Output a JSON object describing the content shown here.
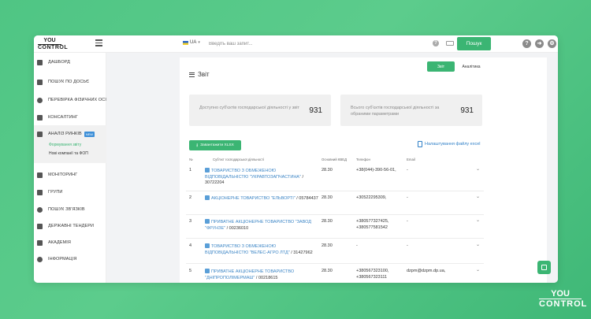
{
  "brand": {
    "logo_line1": "YOU",
    "logo_line2": "CONTROL"
  },
  "topbar": {
    "language": "UA",
    "search_placeholder": "Введіть ваш запит...",
    "search_button": "Пошук",
    "icons": [
      "help-icon",
      "keyboard-icon",
      "question-icon",
      "share-icon",
      "settings-icon"
    ]
  },
  "sidebar": {
    "items": [
      {
        "label": "ДАШБОРД",
        "icon": "grid-icon"
      },
      {
        "label": "ПОШУК ПО ДОСЬЄ",
        "icon": "monitor-icon"
      },
      {
        "label": "ПЕРЕВІРКА ФІЗИЧНИХ ОСІБ",
        "icon": "person-icon"
      },
      {
        "label": "КОНСАЛТИНГ",
        "icon": "briefcase-icon"
      },
      {
        "label": "АНАЛІЗ РИНКІВ",
        "icon": "chart-icon",
        "badge": "NEW"
      },
      {
        "label": "МОНІТОРИНГ",
        "icon": "monitor-icon"
      },
      {
        "label": "ГРУПИ",
        "icon": "folder-icon"
      },
      {
        "label": "ПОШУК ЗВ'ЯЗКІВ",
        "icon": "network-icon"
      },
      {
        "label": "ДЕРЖАВНІ ТЕНДЕРИ",
        "icon": "handshake-icon"
      },
      {
        "label": "АКАДЕМІЯ",
        "icon": "academy-icon"
      },
      {
        "label": "ІНФОРМАЦІЯ",
        "icon": "info-icon"
      }
    ],
    "subitems": [
      {
        "label": "Формування звіту",
        "active": true
      },
      {
        "label": "Нові компанії та ФОП",
        "active": false
      }
    ]
  },
  "report": {
    "tabs": [
      "Звіт",
      "Аналітика"
    ],
    "title": "Звіт",
    "stats": [
      {
        "label": "Доступно суб'єктів господарської діяльності у звіт",
        "value": "931"
      },
      {
        "label": "Всього суб'єктів господарської діяльності за обраними параметрами",
        "value": "931"
      }
    ],
    "download_button": "Завантажити XLSX",
    "excel_settings_link": "Налаштування файлу excel",
    "columns": [
      "№",
      "Суб'єкт господарської діяльності",
      "Основний КВЕД",
      "Телефон",
      "Email"
    ],
    "rows": [
      {
        "n": "1",
        "company": "ТОВАРИСТВО З ОБМЕЖЕНОЮ ВІДПОВІДАЛЬНІСТЮ \"УКРАВТОЗАПЧАСТИНА\"",
        "code": "/ 30722204",
        "kved": "28.30",
        "phone": "+38(044)-390-56-01,",
        "email": "-"
      },
      {
        "n": "2",
        "company": "АКЦІОНЕРНЕ ТОВАРИСТВО \"ЕЛЬВОРТІ\"",
        "code": "/ 05784437",
        "kved": "28.30",
        "phone": "+30522295309,",
        "email": "-"
      },
      {
        "n": "3",
        "company": "ПРИВАТНЕ АКЦІОНЕРНЕ ТОВАРИСТВО \"ЗАВОД \"ФРУНЗЕ\"",
        "code": "/ 00236010",
        "kved": "28.30",
        "phone": "+380577327425, +380577581542",
        "email": "-"
      },
      {
        "n": "4",
        "company": "ТОВАРИСТВО З ОБМЕЖЕНОЮ ВІДПОВІДАЛЬНІСТЮ \"ВЕЛЕС-АГРО ЛТД\"",
        "code": "/ 31427962",
        "kved": "28.30",
        "phone": "-",
        "email": "-"
      },
      {
        "n": "5",
        "company": "ПРИВАТНЕ АКЦІОНЕРНЕ ТОВАРИСТВО \"ДНІПРОПОЛІМЕРМАШ\"",
        "code": "/ 00218615",
        "kved": "28.30",
        "phone": "+380567323100, +380567323111",
        "email": "dzpm@dzpm.dp.ua,"
      }
    ]
  },
  "corner_brand": {
    "line1": "YOU",
    "line2": "CONTROL"
  },
  "colors": {
    "accent": "#3bb573",
    "link": "#3d86c6",
    "background": "#4fc584"
  }
}
